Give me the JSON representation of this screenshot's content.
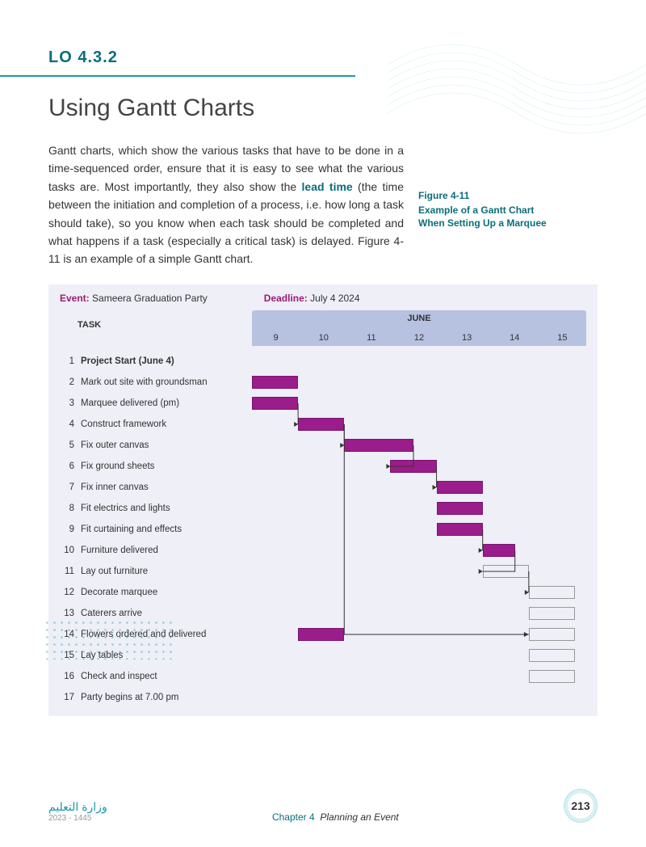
{
  "lo": "LO 4.3.2",
  "title": "Using Gantt Charts",
  "body": {
    "p1a": "Gantt charts, which show the various tasks that have to be done in a time-sequenced order, ensure that it is easy to see what the various tasks are. Most importantly, they also show the ",
    "bold": "lead time",
    "p1b": " (the time between the initiation and completion of a process, i.e. how long a task should take), so you know when each task should be completed and what happens if a task (especially a critical task) is delayed. Figure 4-11 is an example of a simple Gantt chart."
  },
  "figcap": {
    "num": "Figure 4-11",
    "desc": "Example of a Gantt Chart When Setting Up a Marquee"
  },
  "gantt": {
    "event_label": "Event:",
    "event_value": "Sameera Graduation Party",
    "deadline_label": "Deadline:",
    "deadline_value": "July 4 2024",
    "task_head": "TASK",
    "month": "JUNE",
    "days": [
      "9",
      "10",
      "11",
      "12",
      "13",
      "14",
      "15"
    ],
    "tasks": [
      {
        "n": "1",
        "t": "Project Start (June 4)",
        "bold": true
      },
      {
        "n": "2",
        "t": "Mark out site with groundsman"
      },
      {
        "n": "3",
        "t": "Marquee delivered (pm)"
      },
      {
        "n": "4",
        "t": "Construct framework"
      },
      {
        "n": "5",
        "t": "Fix outer canvas"
      },
      {
        "n": "6",
        "t": "Fix ground sheets"
      },
      {
        "n": "7",
        "t": "Fix inner canvas"
      },
      {
        "n": "8",
        "t": "Fit electrics and lights"
      },
      {
        "n": "9",
        "t": "Fit curtaining and effects"
      },
      {
        "n": "10",
        "t": "Furniture delivered"
      },
      {
        "n": "11",
        "t": "Lay out furniture"
      },
      {
        "n": "12",
        "t": "Decorate marquee"
      },
      {
        "n": "13",
        "t": "Caterers arrive"
      },
      {
        "n": "14",
        "t": "Flowers ordered and delivered"
      },
      {
        "n": "15",
        "t": "Lay tables"
      },
      {
        "n": "16",
        "t": "Check and inspect"
      },
      {
        "n": "17",
        "t": "Party begins at 7.00 pm"
      }
    ]
  },
  "footer": {
    "ministry_ar": "وزارة التعليم",
    "ministry_sub": "2023 - 1445",
    "chapter_label": "Chapter 4",
    "chapter_title": "Planning an Event",
    "page": "213"
  },
  "chart_data": {
    "type": "gantt",
    "title": "Example of a Gantt Chart When Setting Up a Marquee",
    "event": "Sameera Graduation Party",
    "deadline": "July 4 2024",
    "x_axis": {
      "label": "JUNE",
      "ticks": [
        9,
        10,
        11,
        12,
        13,
        14,
        15
      ]
    },
    "tasks": [
      {
        "id": 1,
        "name": "Project Start (June 4)",
        "start": null,
        "end": null,
        "milestone": true
      },
      {
        "id": 2,
        "name": "Mark out site with groundsman",
        "start": 9,
        "end": 10,
        "filled": true
      },
      {
        "id": 3,
        "name": "Marquee delivered (pm)",
        "start": 9,
        "end": 10,
        "filled": true
      },
      {
        "id": 4,
        "name": "Construct framework",
        "start": 10,
        "end": 11,
        "filled": true
      },
      {
        "id": 5,
        "name": "Fix outer canvas",
        "start": 11,
        "end": 12.5,
        "filled": true
      },
      {
        "id": 6,
        "name": "Fix ground sheets",
        "start": 12,
        "end": 13,
        "filled": true
      },
      {
        "id": 7,
        "name": "Fix inner canvas",
        "start": 13,
        "end": 14,
        "filled": true
      },
      {
        "id": 8,
        "name": "Fit electrics and lights",
        "start": 13,
        "end": 14,
        "filled": true
      },
      {
        "id": 9,
        "name": "Fit curtaining and effects",
        "start": 13,
        "end": 14,
        "filled": true
      },
      {
        "id": 10,
        "name": "Furniture delivered",
        "start": 14,
        "end": 14.7,
        "filled": true
      },
      {
        "id": 11,
        "name": "Lay out furniture",
        "start": 14,
        "end": 15,
        "filled": false
      },
      {
        "id": 12,
        "name": "Decorate marquee",
        "start": 15,
        "end": 16,
        "filled": false
      },
      {
        "id": 13,
        "name": "Caterers arrive",
        "start": 15,
        "end": 16,
        "filled": false
      },
      {
        "id": 14,
        "name": "Flowers ordered and delivered",
        "start": 10,
        "end": 11,
        "filled": true,
        "arrow_to_end": true,
        "secondary": {
          "start": 15,
          "end": 16,
          "filled": false
        }
      },
      {
        "id": 15,
        "name": "Lay tables",
        "start": 15,
        "end": 16,
        "filled": false
      },
      {
        "id": 16,
        "name": "Check and inspect",
        "start": 15,
        "end": 16,
        "filled": false
      },
      {
        "id": 17,
        "name": "Party begins at 7.00 pm",
        "start": null,
        "end": null,
        "milestone": true
      }
    ],
    "dependencies": [
      [
        3,
        4
      ],
      [
        4,
        5
      ],
      [
        5,
        6
      ],
      [
        6,
        7
      ],
      [
        9,
        10
      ],
      [
        10,
        11
      ],
      [
        11,
        12
      ],
      [
        14,
        14
      ]
    ]
  }
}
